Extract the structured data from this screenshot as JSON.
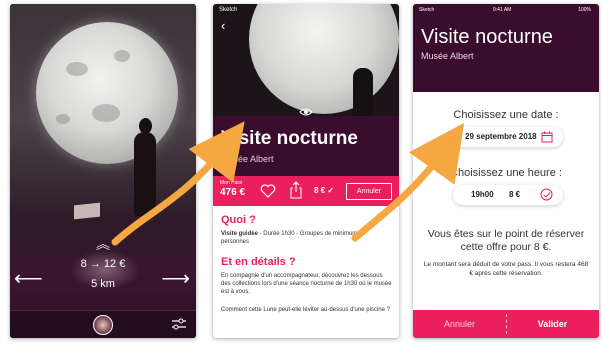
{
  "screen1": {
    "chevron": "︽",
    "price_range": "8 → 12 €",
    "distance": "5 km",
    "arrow_left": "⟵",
    "arrow_right": "⟶"
  },
  "screen2": {
    "status_left": "Sketch",
    "back": "‹",
    "title": "Visite nocturne",
    "subtitle": "Musée Albert",
    "pass_label": "Mon Pass",
    "pass_value": "476 €",
    "price": "8 € ✓",
    "cancel": "Annuler",
    "what_title": "Quoi ?",
    "what_body_strong": "Visite guidée",
    "what_body": " - Durée 1h30 - Groupes de minimum 15 personnes",
    "details_title": "Et en détails ?",
    "details_body": "En compagnie d'un accompagnateur, découvrez les dessous des collections lors d'une séance nocturne de 1h30 où le musée est à vous.",
    "question": "Comment cette Lune peut-elle léviter au-dessus d'une piscine ?"
  },
  "screen3": {
    "status_left": "Sketch",
    "status_time": "9:41 AM",
    "status_battery": "100%",
    "title": "Visite nocturne",
    "subtitle": "Musée Albert",
    "date_label": "Choisissez une date :",
    "date_value": "29 septembre 2018",
    "time_label": "Choisissez une heure :",
    "time_value": "19h00",
    "time_price": "8 €",
    "info": "Vous êtes sur le point de réserver cette offre pour 8 €.",
    "note": "Le montant sera déduit de votre pass. Il vous restera 468 € après cette réservation.",
    "cancel": "Annuler",
    "validate": "Valider"
  },
  "colors": {
    "accent": "#ec1f5e",
    "deep_purple": "#3a0c2e",
    "arrow_orange": "#f5a742"
  }
}
